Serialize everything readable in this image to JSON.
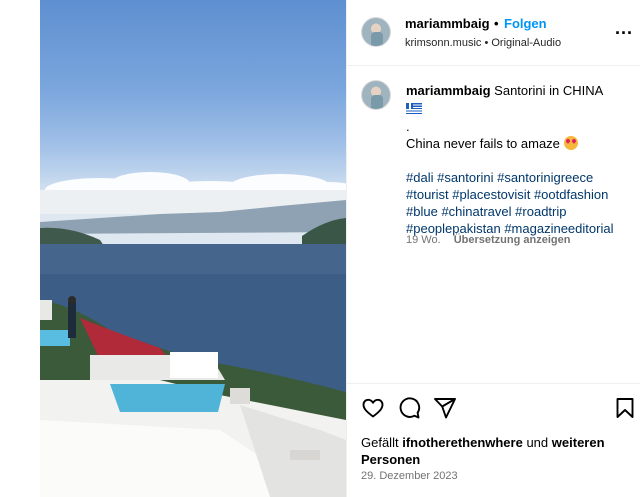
{
  "post": {
    "username": "mariammbaig",
    "follow_label": "Folgen",
    "separator": "•",
    "audio": "krimsonn.music • Original-Audio",
    "more_label": "..."
  },
  "caption": {
    "username": "mariammbaig",
    "title": "Santorini in CHINA",
    "dot": ".",
    "text": "China never fails to amaze",
    "hashtag_lines": [
      [
        "#dali",
        "#santorini",
        "#santorinigreece"
      ],
      [
        "#tourist",
        "#placestovisit",
        "#ootdfashion"
      ],
      [
        "#blue",
        "#chinatravel",
        "#roadtrip"
      ],
      [
        "#peoplepakistan",
        "#magazineeditorial"
      ]
    ],
    "age": "19 Wo.",
    "translate_label": "Übersetzung anzeigen"
  },
  "actions": {
    "liked_prefix": "Gefällt",
    "liked_user": "ifnotherethenwhere",
    "liked_and": "und",
    "liked_others": "weiteren Personen",
    "date": "29. Dezember 2023"
  },
  "icons": [
    "heart-icon",
    "comment-icon",
    "share-icon",
    "bookmark-icon",
    "more-icon"
  ]
}
